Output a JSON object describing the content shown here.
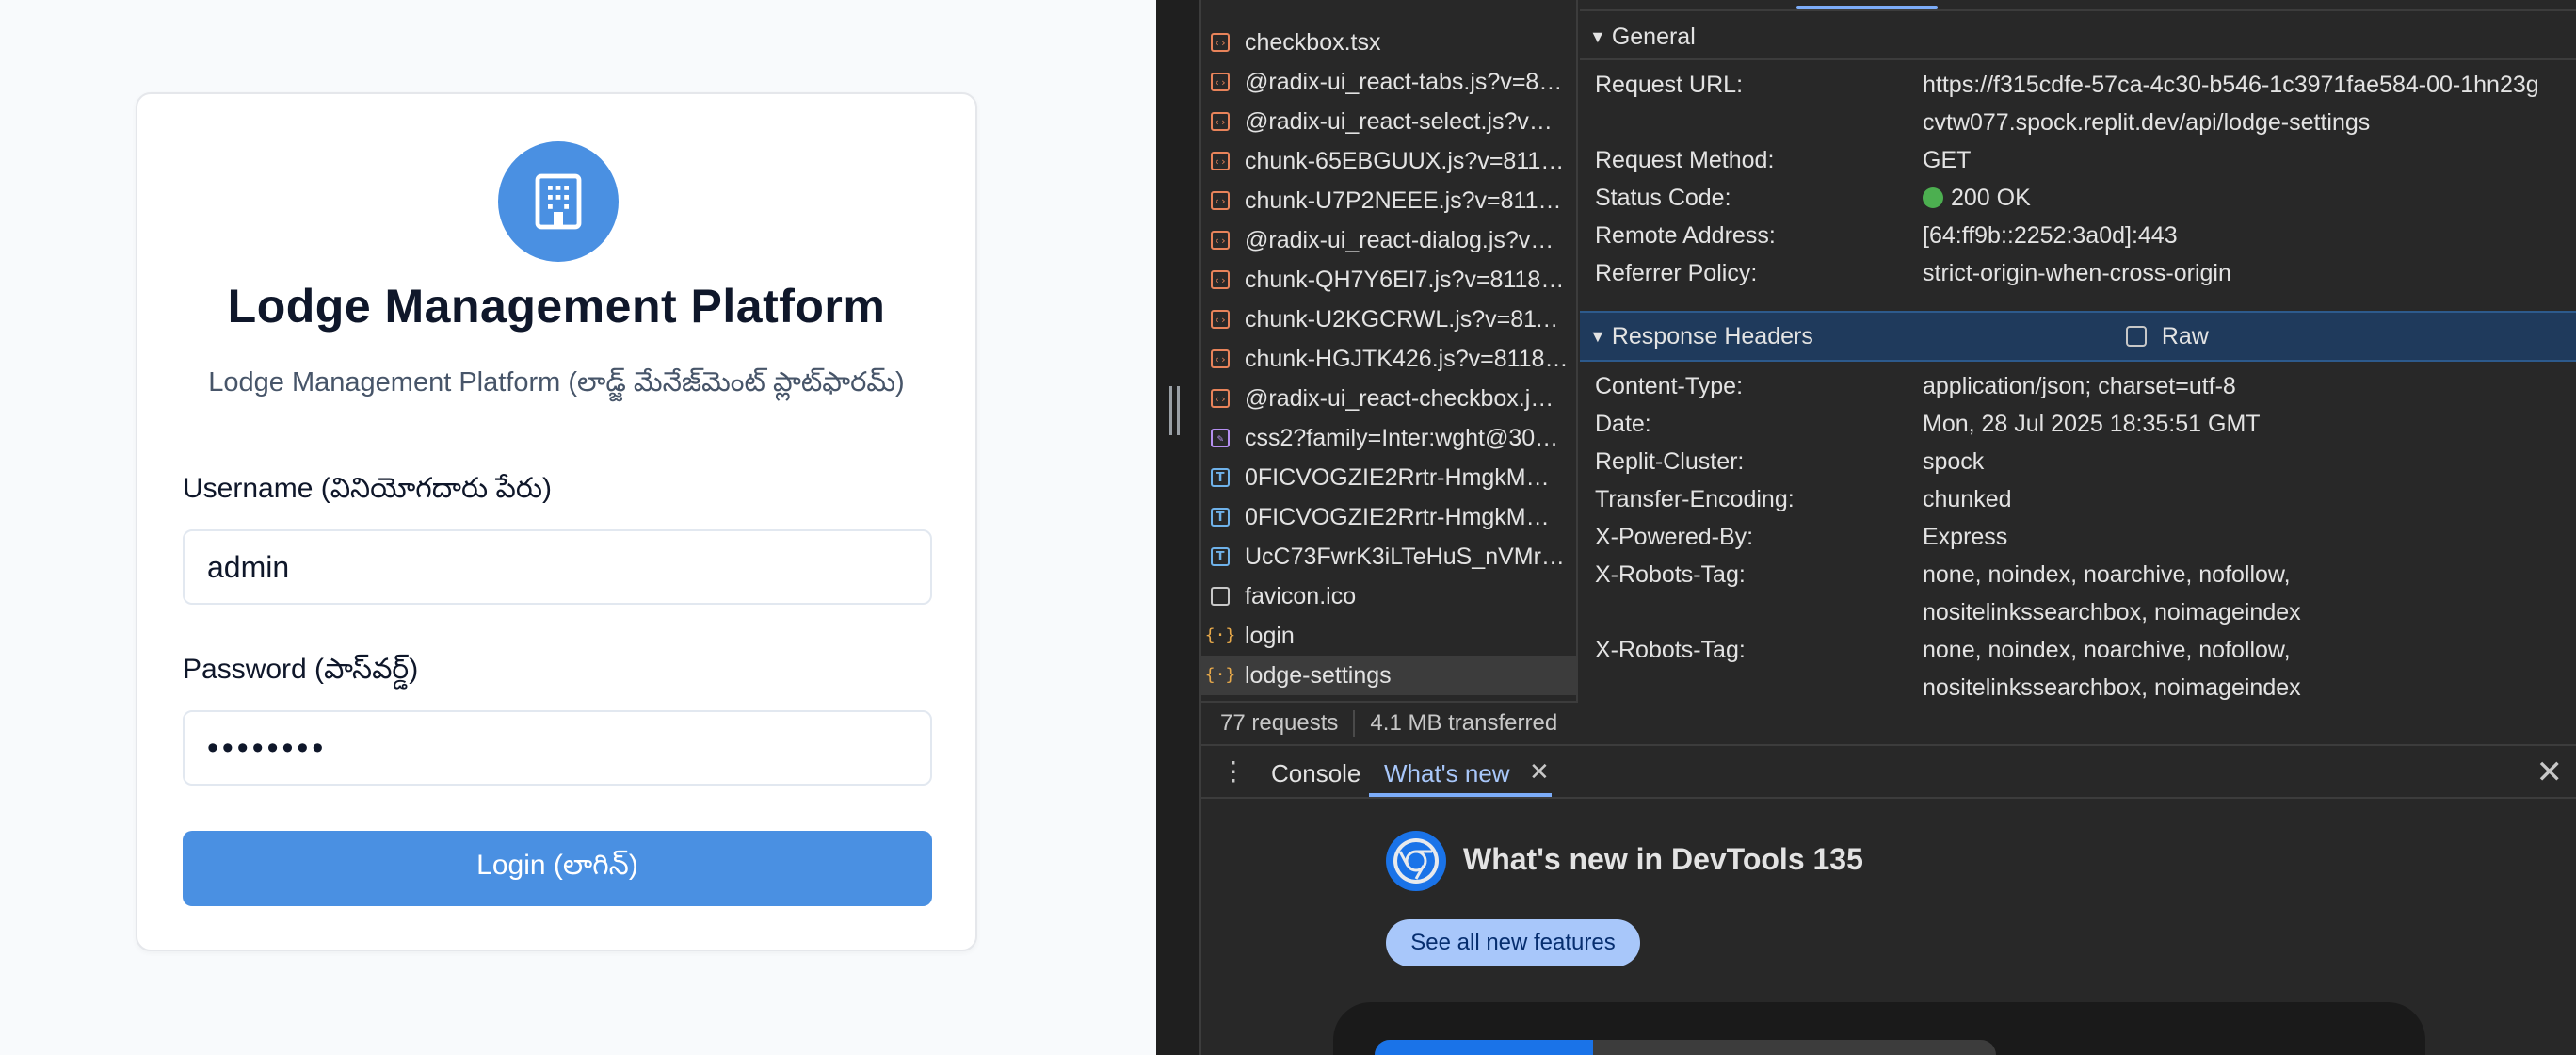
{
  "login": {
    "title": "Lodge Management Platform",
    "subtitle": "Lodge Management Platform (లాడ్జ్ మేనేజ్‌మెంట్ ప్లాట్‌ఫారమ్)",
    "username_label": "Username (వినియోగదారు పేరు)",
    "username_value": "admin",
    "password_label": "Password (పాస్‌వర్డ్)",
    "password_value": "••••••••",
    "login_button": "Login (లాగిన్)",
    "brand_color": "#4a90e2",
    "logo_icon": "building-icon"
  },
  "network": {
    "requests": [
      {
        "name": "checkbox.tsx",
        "type": "script"
      },
      {
        "name": "@radix-ui_react-tabs.js?v=8…",
        "type": "script"
      },
      {
        "name": "@radix-ui_react-select.js?v…",
        "type": "script"
      },
      {
        "name": "chunk-65EBGUUX.js?v=811…",
        "type": "script"
      },
      {
        "name": "chunk-U7P2NEEE.js?v=8118…",
        "type": "script"
      },
      {
        "name": "@radix-ui_react-dialog.js?v…",
        "type": "script"
      },
      {
        "name": "chunk-QH7Y6EI7.js?v=81184…",
        "type": "script"
      },
      {
        "name": "chunk-U2KGCRWL.js?v=811…",
        "type": "script"
      },
      {
        "name": "chunk-HGJTK426.js?v=8118…",
        "type": "script"
      },
      {
        "name": "@radix-ui_react-checkbox.j…",
        "type": "script"
      },
      {
        "name": "css2?family=Inter:wght@30…",
        "type": "css"
      },
      {
        "name": "0FICVOGZIE2Rrtr-HmgkMW…",
        "type": "font"
      },
      {
        "name": "0FICVOGZIE2Rrtr-HmgkMW…",
        "type": "font"
      },
      {
        "name": "UcC73FwrK3iLTeHuS_nVMr…",
        "type": "font"
      },
      {
        "name": "favicon.ico",
        "type": "doc"
      },
      {
        "name": "login",
        "type": "fetch"
      },
      {
        "name": "lodge-settings",
        "type": "fetch",
        "selected": true
      }
    ],
    "requests_count": "77 requests",
    "transferred": "4.1 MB transferred"
  },
  "general": {
    "header": "General",
    "rows": [
      {
        "key": "Request URL:",
        "value": "https://f315cdfe-57ca-4c30-b546-1c3971fae584-00-1hn23g",
        "value2": "cvtw077.spock.replit.dev/api/lodge-settings"
      },
      {
        "key": "Request Method:",
        "value": "GET"
      },
      {
        "key": "Status Code:",
        "value": "200 OK"
      },
      {
        "key": "Remote Address:",
        "value": "[64:ff9b::2252:3a0d]:443"
      },
      {
        "key": "Referrer Policy:",
        "value": "strict-origin-when-cross-origin"
      }
    ]
  },
  "response_headers": {
    "header": "Response Headers",
    "raw_label": "Raw",
    "rows": [
      {
        "key": "Content-Type:",
        "value": "application/json; charset=utf-8"
      },
      {
        "key": "Date:",
        "value": "Mon, 28 Jul 2025 18:35:51 GMT"
      },
      {
        "key": "Replit-Cluster:",
        "value": "spock"
      },
      {
        "key": "Transfer-Encoding:",
        "value": "chunked"
      },
      {
        "key": "X-Powered-By:",
        "value": "Express"
      },
      {
        "key": "X-Robots-Tag:",
        "value": "none, noindex, noarchive, nofollow,",
        "value2": "nositelinkssearchbox, noimageindex"
      },
      {
        "key": "X-Robots-Tag:",
        "value": "none, noindex, noarchive, nofollow,",
        "value2": "nositelinkssearchbox, noimageindex"
      }
    ],
    "highlight_color": "#1f3a5c"
  },
  "drawer": {
    "tabs": [
      "Console",
      "What's new"
    ],
    "whatsnew_title": "What's new in DevTools 135",
    "see_all_button": "See all new features"
  }
}
